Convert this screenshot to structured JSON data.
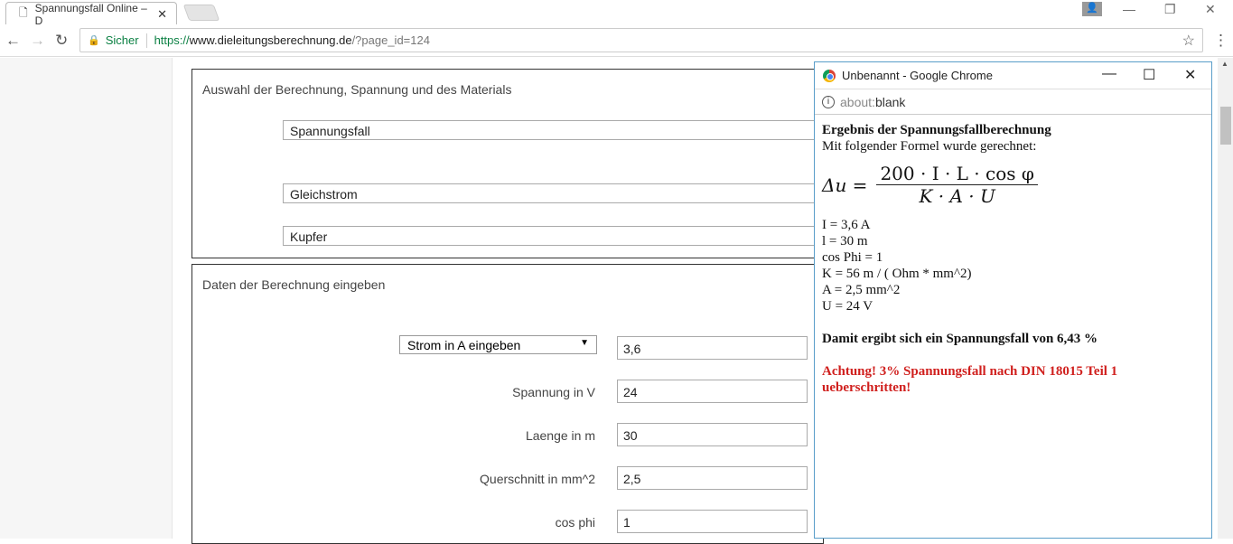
{
  "browser": {
    "tab_title": "Spannungsfall Online – D",
    "secure_label": "Sicher",
    "url_scheme": "https://",
    "url_host": "www.dieleitungsberechnung.de",
    "url_path": "/?page_id=124"
  },
  "section1": {
    "title": "Auswahl der Berechnung, Spannung und des Materials",
    "calc_type": "Spannungsfall",
    "current_type": "Gleichstrom",
    "material": "Kupfer"
  },
  "section2": {
    "title": "Daten der Berechnung eingeben",
    "rows": [
      {
        "label": "Strom in A eingeben",
        "value": "3,6"
      },
      {
        "label": "Spannung in V",
        "value": "24"
      },
      {
        "label": "Laenge in m",
        "value": "30"
      },
      {
        "label": "Querschnitt in mm^2",
        "value": "2,5"
      },
      {
        "label": "cos phi",
        "value": "1"
      }
    ]
  },
  "popup": {
    "window_title": "Unbenannt - Google Chrome",
    "url_prefix": "about:",
    "url_rest": "blank",
    "heading": "Ergebnis der Spannungsfallberechnung",
    "intro": "Mit folgender Formel wurde gerechnet:",
    "formula_lhs": "Δu =",
    "formula_num": "200 · I · L · cos φ",
    "formula_den": "K · A · U",
    "values": [
      "I = 3,6 A",
      "l = 30 m",
      "cos Phi = 1",
      "K = 56 m / ( Ohm * mm^2)",
      "A = 2,5 mm^2",
      "U = 24 V"
    ],
    "result": "Damit ergibt sich ein Spannungsfall von 6,43 %",
    "warning": "Achtung! 3% Spannungsfall nach DIN 18015 Teil 1 ueberschritten!"
  }
}
